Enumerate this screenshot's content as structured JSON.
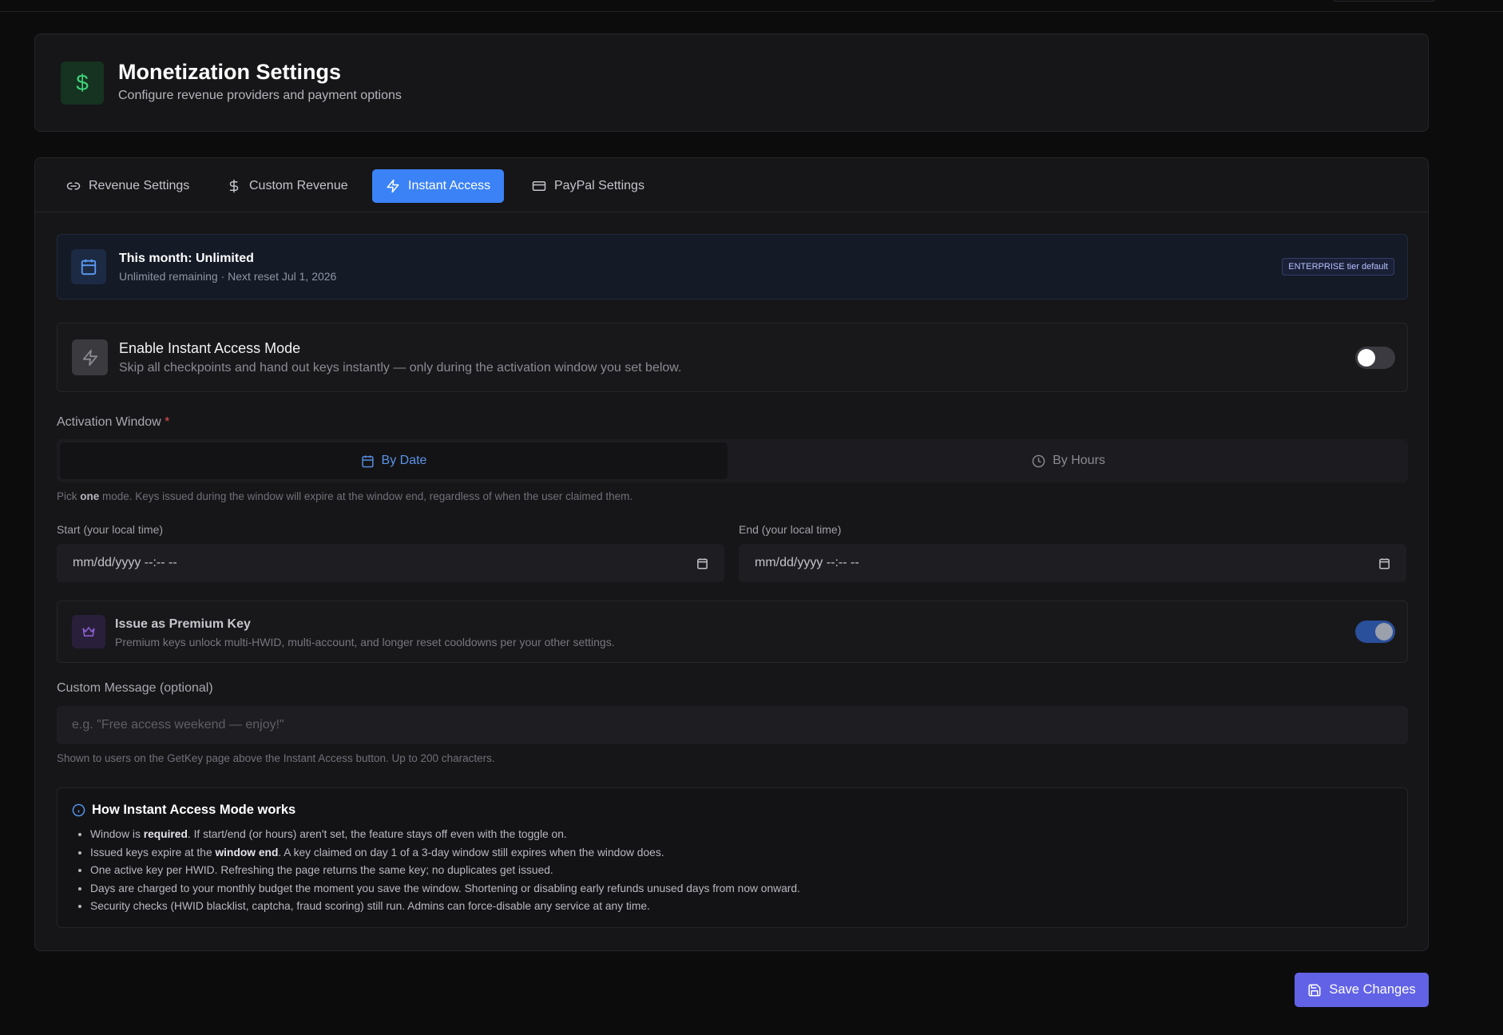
{
  "header": {
    "title": "Monetization Settings",
    "subtitle": "Configure revenue providers and payment options",
    "icon": "dollar-icon",
    "icon_glyph": "$"
  },
  "tabs": [
    {
      "label": "Revenue Settings",
      "icon": "link-icon",
      "active": false
    },
    {
      "label": "Custom Revenue",
      "icon": "dollar-icon",
      "active": false
    },
    {
      "label": "Instant Access",
      "icon": "lightning-icon",
      "active": true
    },
    {
      "label": "PayPal Settings",
      "icon": "credit-card-icon",
      "active": false
    }
  ],
  "usage": {
    "title": "This month: Unlimited",
    "subtitle": "Unlimited remaining · Next reset Jul 1, 2026",
    "badge": "ENTERPRISE tier default"
  },
  "instant_mode": {
    "title": "Enable Instant Access Mode",
    "description": "Skip all checkpoints and hand out keys instantly — only during the activation window you set below.",
    "enabled": false
  },
  "activation_window": {
    "label": "Activation Window",
    "required_mark": "*",
    "options": [
      {
        "label": "By Date",
        "active": true
      },
      {
        "label": "By Hours",
        "active": false
      }
    ],
    "hint_before": "Pick ",
    "hint_bold": "one",
    "hint_after": " mode. Keys issued during the window will expire at the window end, regardless of when the user claimed them."
  },
  "start": {
    "label": "Start (your local time)",
    "value": "mm/dd/yyyy --:-- --"
  },
  "end": {
    "label": "End (your local time)",
    "value": "mm/dd/yyyy --:-- --"
  },
  "premium": {
    "title": "Issue as Premium Key",
    "description": "Premium keys unlock multi-HWID, multi-account, and longer reset cooldowns per your other settings.",
    "enabled": true
  },
  "custom_message": {
    "label": "Custom Message (optional)",
    "placeholder": "e.g. \"Free access weekend — enjoy!\"",
    "hint": "Shown to users on the GetKey page above the Instant Access button. Up to 200 characters."
  },
  "info": {
    "title": "How Instant Access Mode works",
    "items": [
      {
        "pre": "Window is ",
        "bold": "required",
        "post": ". If start/end (or hours) aren't set, the feature stays off even with the toggle on."
      },
      {
        "pre": "Issued keys expire at the ",
        "bold": "window end",
        "post": ". A key claimed on day 1 of a 3-day window still expires when the window does."
      },
      {
        "pre": "One active key per HWID. Refreshing the page returns the same key; no duplicates get issued.",
        "bold": "",
        "post": ""
      },
      {
        "pre": "Days are charged to your monthly budget the moment you save the window. Shortening or disabling early refunds unused days from now onward.",
        "bold": "",
        "post": ""
      },
      {
        "pre": "Security checks (HWID blacklist, captcha, fraud scoring) still run. Admins can force-disable any service at any time.",
        "bold": "",
        "post": ""
      }
    ]
  },
  "save_button": {
    "label": "Save Changes"
  },
  "colors": {
    "accent_blue": "#3b82f6",
    "save_purple": "#6262e6",
    "dollar_green": "#3fd07a",
    "required_red": "#e05252"
  }
}
